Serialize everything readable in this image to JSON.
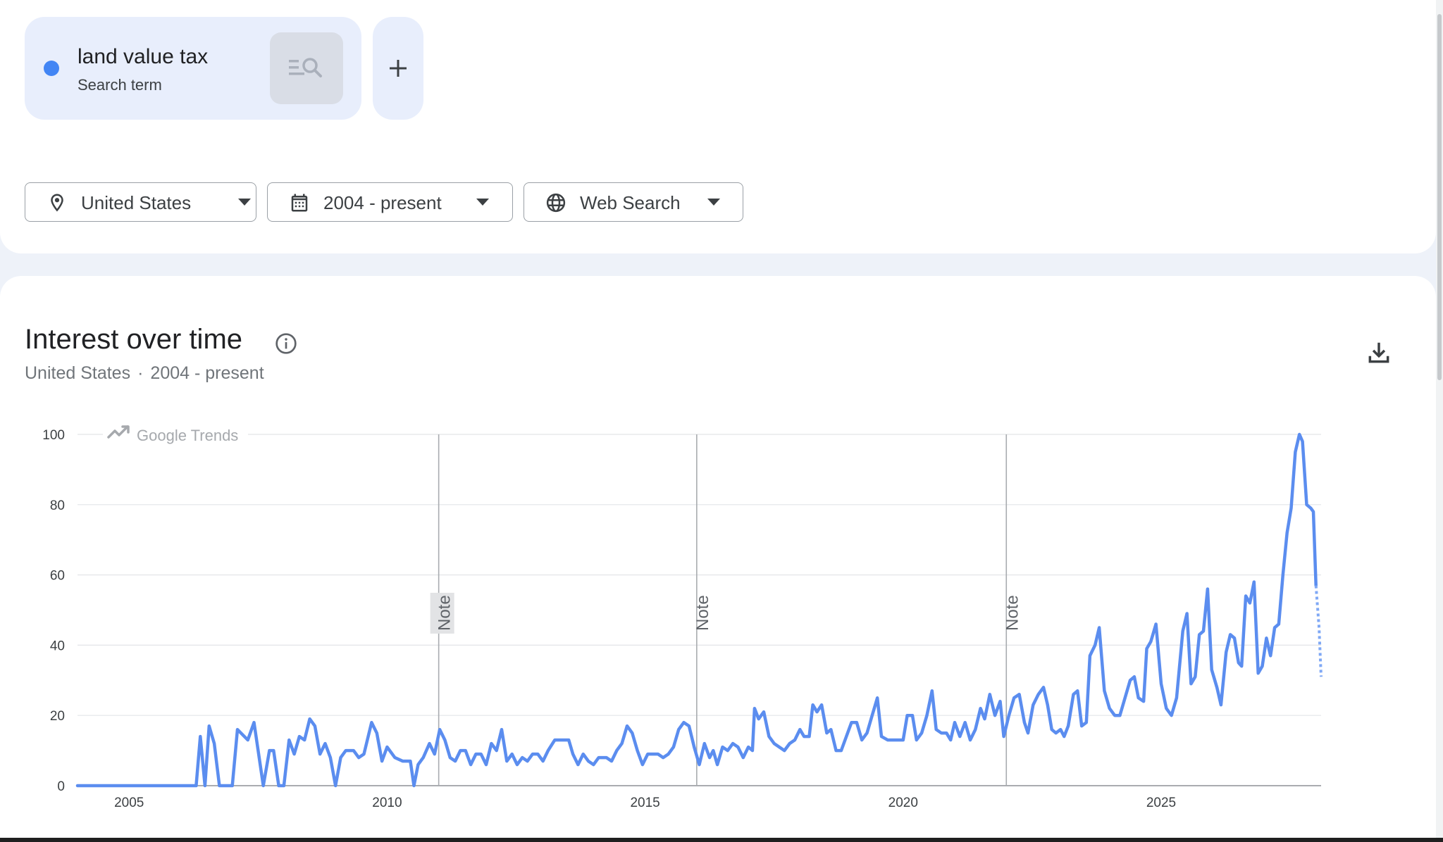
{
  "search_term": {
    "name": "land value tax",
    "type": "Search term",
    "color": "#4285f4"
  },
  "icons": {
    "explore": "search-explore-icon",
    "add": "plus-icon",
    "location": "location-pin-icon",
    "date": "calendar-icon",
    "property": "globe-icon",
    "info": "info-icon",
    "download": "download-icon",
    "trends": "trending-up-icon"
  },
  "filters": {
    "location": "United States",
    "date_range": "2004 - present",
    "property": "Web Search"
  },
  "interest_over_time": {
    "title": "Interest over time",
    "subtitle_location": "United States",
    "subtitle_separator": "·",
    "subtitle_range": "2004 - present",
    "watermark": "Google Trends"
  },
  "chart_data": {
    "type": "line",
    "title": "",
    "xlabel": "",
    "ylabel": "",
    "xlim": [
      2004.0,
      2026.55
    ],
    "ylim": [
      0,
      100
    ],
    "yticks": [
      0,
      20,
      40,
      60,
      80,
      100
    ],
    "xticks": [
      2005,
      2010,
      2015,
      2020,
      2025
    ],
    "grid": true,
    "line_color": "#5b8def",
    "notes": [
      {
        "x": 2011.0,
        "label": "Note"
      },
      {
        "x": 2016.0,
        "label": "Note"
      },
      {
        "x": 2022.0,
        "label": "Note"
      }
    ],
    "series": [
      {
        "points": [
          [
            2004.0,
            0
          ],
          [
            2005.0,
            0
          ],
          [
            2006.0,
            0
          ],
          [
            2006.3,
            0
          ],
          [
            2006.38,
            14
          ],
          [
            2006.47,
            0
          ],
          [
            2006.55,
            17
          ],
          [
            2006.65,
            12
          ],
          [
            2006.75,
            0
          ],
          [
            2007.0,
            0
          ],
          [
            2007.1,
            16
          ],
          [
            2007.3,
            13
          ],
          [
            2007.42,
            18
          ],
          [
            2007.6,
            0
          ],
          [
            2007.72,
            10
          ],
          [
            2007.8,
            10
          ],
          [
            2007.9,
            0
          ],
          [
            2008.0,
            0
          ],
          [
            2008.1,
            13
          ],
          [
            2008.2,
            9
          ],
          [
            2008.3,
            14
          ],
          [
            2008.4,
            13
          ],
          [
            2008.5,
            19
          ],
          [
            2008.6,
            17
          ],
          [
            2008.7,
            9
          ],
          [
            2008.8,
            12
          ],
          [
            2008.9,
            8
          ],
          [
            2009.0,
            0
          ],
          [
            2009.1,
            8
          ],
          [
            2009.2,
            10
          ],
          [
            2009.35,
            10
          ],
          [
            2009.45,
            8
          ],
          [
            2009.55,
            9
          ],
          [
            2009.7,
            18
          ],
          [
            2009.8,
            15
          ],
          [
            2009.9,
            7
          ],
          [
            2010.0,
            11
          ],
          [
            2010.15,
            8
          ],
          [
            2010.3,
            7
          ],
          [
            2010.45,
            7
          ],
          [
            2010.52,
            0
          ],
          [
            2010.6,
            6
          ],
          [
            2010.7,
            8
          ],
          [
            2010.82,
            12
          ],
          [
            2010.92,
            9
          ],
          [
            2011.02,
            16
          ],
          [
            2011.12,
            13
          ],
          [
            2011.22,
            8
          ],
          [
            2011.32,
            7
          ],
          [
            2011.42,
            10
          ],
          [
            2011.52,
            10
          ],
          [
            2011.62,
            6
          ],
          [
            2011.72,
            9
          ],
          [
            2011.82,
            9
          ],
          [
            2011.92,
            6
          ],
          [
            2012.02,
            12
          ],
          [
            2012.12,
            10
          ],
          [
            2012.22,
            16
          ],
          [
            2012.32,
            7
          ],
          [
            2012.42,
            9
          ],
          [
            2012.52,
            6
          ],
          [
            2012.62,
            8
          ],
          [
            2012.72,
            7
          ],
          [
            2012.82,
            9
          ],
          [
            2012.92,
            9
          ],
          [
            2013.02,
            7
          ],
          [
            2013.12,
            10
          ],
          [
            2013.25,
            13
          ],
          [
            2013.4,
            13
          ],
          [
            2013.52,
            13
          ],
          [
            2013.6,
            9
          ],
          [
            2013.7,
            6
          ],
          [
            2013.8,
            9
          ],
          [
            2013.9,
            7
          ],
          [
            2014.0,
            6
          ],
          [
            2014.1,
            8
          ],
          [
            2014.25,
            8
          ],
          [
            2014.35,
            7
          ],
          [
            2014.45,
            10
          ],
          [
            2014.55,
            12
          ],
          [
            2014.65,
            17
          ],
          [
            2014.75,
            15
          ],
          [
            2014.85,
            10
          ],
          [
            2014.95,
            6
          ],
          [
            2015.05,
            9
          ],
          [
            2015.15,
            9
          ],
          [
            2015.25,
            9
          ],
          [
            2015.35,
            8
          ],
          [
            2015.45,
            9
          ],
          [
            2015.55,
            11
          ],
          [
            2015.65,
            16
          ],
          [
            2015.75,
            18
          ],
          [
            2015.85,
            17
          ],
          [
            2015.95,
            11
          ],
          [
            2016.05,
            6
          ],
          [
            2016.15,
            12
          ],
          [
            2016.25,
            8
          ],
          [
            2016.32,
            10
          ],
          [
            2016.4,
            6
          ],
          [
            2016.5,
            11
          ],
          [
            2016.6,
            10
          ],
          [
            2016.7,
            12
          ],
          [
            2016.8,
            11
          ],
          [
            2016.9,
            8
          ],
          [
            2017.0,
            11
          ],
          [
            2017.08,
            10
          ],
          [
            2017.12,
            22
          ],
          [
            2017.2,
            19
          ],
          [
            2017.3,
            21
          ],
          [
            2017.4,
            14
          ],
          [
            2017.5,
            12
          ],
          [
            2017.6,
            11
          ],
          [
            2017.7,
            10
          ],
          [
            2017.8,
            12
          ],
          [
            2017.9,
            13
          ],
          [
            2018.0,
            16
          ],
          [
            2018.08,
            14
          ],
          [
            2018.18,
            14
          ],
          [
            2018.25,
            23
          ],
          [
            2018.33,
            21
          ],
          [
            2018.42,
            23
          ],
          [
            2018.52,
            15
          ],
          [
            2018.6,
            16
          ],
          [
            2018.7,
            10
          ],
          [
            2018.8,
            10
          ],
          [
            2018.9,
            14
          ],
          [
            2019.0,
            18
          ],
          [
            2019.1,
            18
          ],
          [
            2019.2,
            13
          ],
          [
            2019.3,
            15
          ],
          [
            2019.4,
            20
          ],
          [
            2019.5,
            25
          ],
          [
            2019.58,
            14
          ],
          [
            2019.7,
            13
          ],
          [
            2019.8,
            13
          ],
          [
            2019.9,
            13
          ],
          [
            2020.0,
            13
          ],
          [
            2020.08,
            20
          ],
          [
            2020.18,
            20
          ],
          [
            2020.26,
            13
          ],
          [
            2020.36,
            15
          ],
          [
            2020.46,
            20
          ],
          [
            2020.56,
            27
          ],
          [
            2020.64,
            16
          ],
          [
            2020.74,
            15
          ],
          [
            2020.84,
            15
          ],
          [
            2020.92,
            13
          ],
          [
            2021.0,
            18
          ],
          [
            2021.1,
            14
          ],
          [
            2021.2,
            18
          ],
          [
            2021.3,
            13
          ],
          [
            2021.4,
            16
          ],
          [
            2021.5,
            22
          ],
          [
            2021.58,
            19
          ],
          [
            2021.68,
            26
          ],
          [
            2021.78,
            20
          ],
          [
            2021.88,
            24
          ],
          [
            2021.95,
            14
          ],
          [
            2022.05,
            20
          ],
          [
            2022.15,
            25
          ],
          [
            2022.25,
            26
          ],
          [
            2022.35,
            18
          ],
          [
            2022.42,
            15
          ],
          [
            2022.52,
            23
          ],
          [
            2022.62,
            26
          ],
          [
            2022.72,
            28
          ],
          [
            2022.8,
            23
          ],
          [
            2022.88,
            16
          ],
          [
            2022.96,
            15
          ],
          [
            2023.05,
            16
          ],
          [
            2023.12,
            14
          ],
          [
            2023.2,
            17
          ],
          [
            2023.3,
            26
          ],
          [
            2023.38,
            27
          ],
          [
            2023.46,
            17
          ],
          [
            2023.55,
            18
          ],
          [
            2023.62,
            37
          ],
          [
            2023.72,
            40
          ],
          [
            2023.8,
            45
          ],
          [
            2023.9,
            27
          ],
          [
            2024.0,
            22
          ],
          [
            2024.1,
            20
          ],
          [
            2024.2,
            20
          ],
          [
            2024.3,
            25
          ],
          [
            2024.4,
            30
          ],
          [
            2024.48,
            31
          ],
          [
            2024.56,
            25
          ],
          [
            2024.66,
            24
          ],
          [
            2024.72,
            39
          ],
          [
            2024.8,
            41
          ],
          [
            2024.9,
            46
          ],
          [
            2025.0,
            29
          ],
          [
            2025.1,
            22
          ],
          [
            2025.2,
            20
          ],
          [
            2025.3,
            25
          ],
          [
            2025.42,
            44
          ],
          [
            2025.5,
            49
          ],
          [
            2025.58,
            29
          ],
          [
            2025.66,
            31
          ],
          [
            2025.74,
            43
          ],
          [
            2025.82,
            44
          ],
          [
            2025.9,
            56
          ],
          [
            2025.98,
            33
          ],
          [
            2026.08,
            28
          ],
          [
            2026.16,
            23
          ],
          [
            2026.26,
            38
          ],
          [
            2026.34,
            43
          ],
          [
            2026.42,
            42
          ],
          [
            2026.5,
            35
          ],
          [
            2026.56,
            34
          ],
          [
            2026.64,
            54
          ],
          [
            2026.72,
            52
          ],
          [
            2026.8,
            58
          ],
          [
            2026.88,
            32
          ],
          [
            2026.96,
            34
          ],
          [
            2027.04,
            42
          ],
          [
            2027.12,
            37
          ],
          [
            2027.2,
            45
          ],
          [
            2027.28,
            46
          ],
          [
            2027.36,
            60
          ],
          [
            2027.44,
            72
          ],
          [
            2027.52,
            79
          ],
          [
            2027.6,
            95
          ],
          [
            2027.68,
            100
          ],
          [
            2027.74,
            98
          ],
          [
            2027.82,
            80
          ],
          [
            2027.9,
            79
          ],
          [
            2027.95,
            78
          ],
          [
            2028.0,
            57
          ]
        ],
        "partial": [
          [
            2028.0,
            57
          ],
          [
            2028.06,
            45
          ],
          [
            2028.1,
            31
          ]
        ]
      }
    ]
  }
}
